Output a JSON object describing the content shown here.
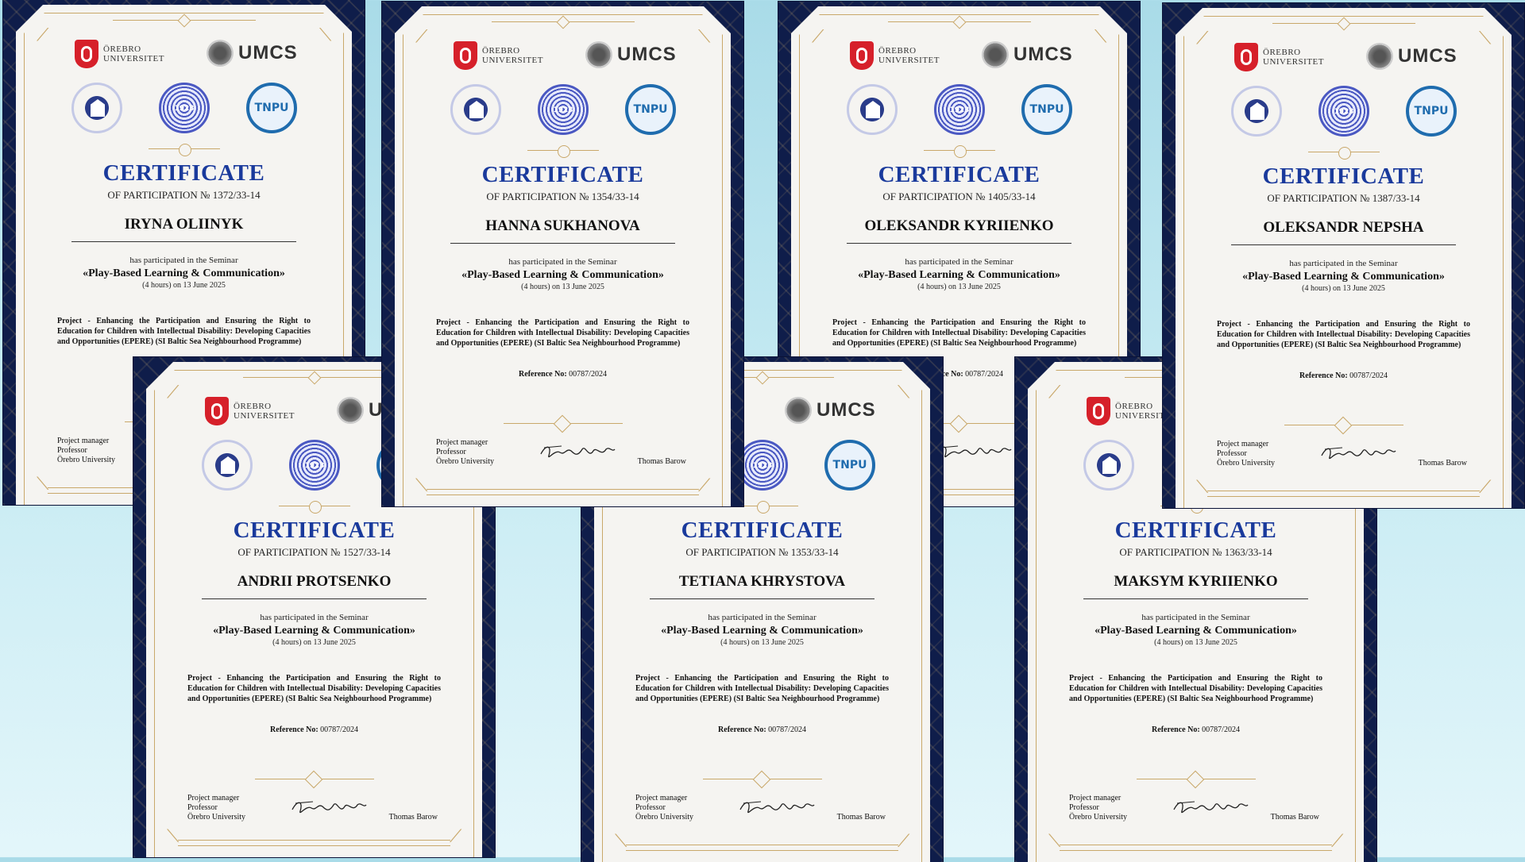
{
  "common": {
    "orebro_line1": "ÖREBRO",
    "orebro_line2": "UNIVERSITET",
    "umcs": "UMCS",
    "title": "CERTIFICATE",
    "participated": "has participated in the Seminar",
    "seminar": "«Play-Based Learning & Communication»",
    "hours": "(4 hours) on 13 June 2025",
    "project": "Project - Enhancing the Participation and Ensuring the Right to Education for Children with Intellectual Disability: Developing Capacities and Opportunities (EPERE) (SI Baltic Sea Neighbourhood Programme)",
    "reference_label": "Reference No:",
    "reference_value": "00787/2024",
    "manager_role": "Project manager",
    "manager_title": "Professor",
    "manager_org": "Örebro University",
    "signer": "Thomas Barow"
  },
  "certificates": [
    {
      "name": "IRYNA OLIINYK",
      "subtitle": "OF PARTICIPATION № 1372/33-14"
    },
    {
      "name": "HANNA SUKHANOVA",
      "subtitle": "OF PARTICIPATION № 1354/33-14"
    },
    {
      "name": "OLEKSANDR KYRIIENKO",
      "subtitle": "OF PARTICIPATION № 1405/33-14"
    },
    {
      "name": "OLEKSANDR NEPSHA",
      "subtitle": "OF PARTICIPATION № 1387/33-14"
    },
    {
      "name": "ANDRII PROTSENKO",
      "subtitle": "OF PARTICIPATION № 1527/33-14"
    },
    {
      "name": "TETIANA KHRYSTOVA",
      "subtitle": "OF PARTICIPATION № 1353/33-14"
    },
    {
      "name": "MAKSYM KYRIIENKO",
      "subtitle": "OF PARTICIPATION № 1363/33-14"
    }
  ]
}
